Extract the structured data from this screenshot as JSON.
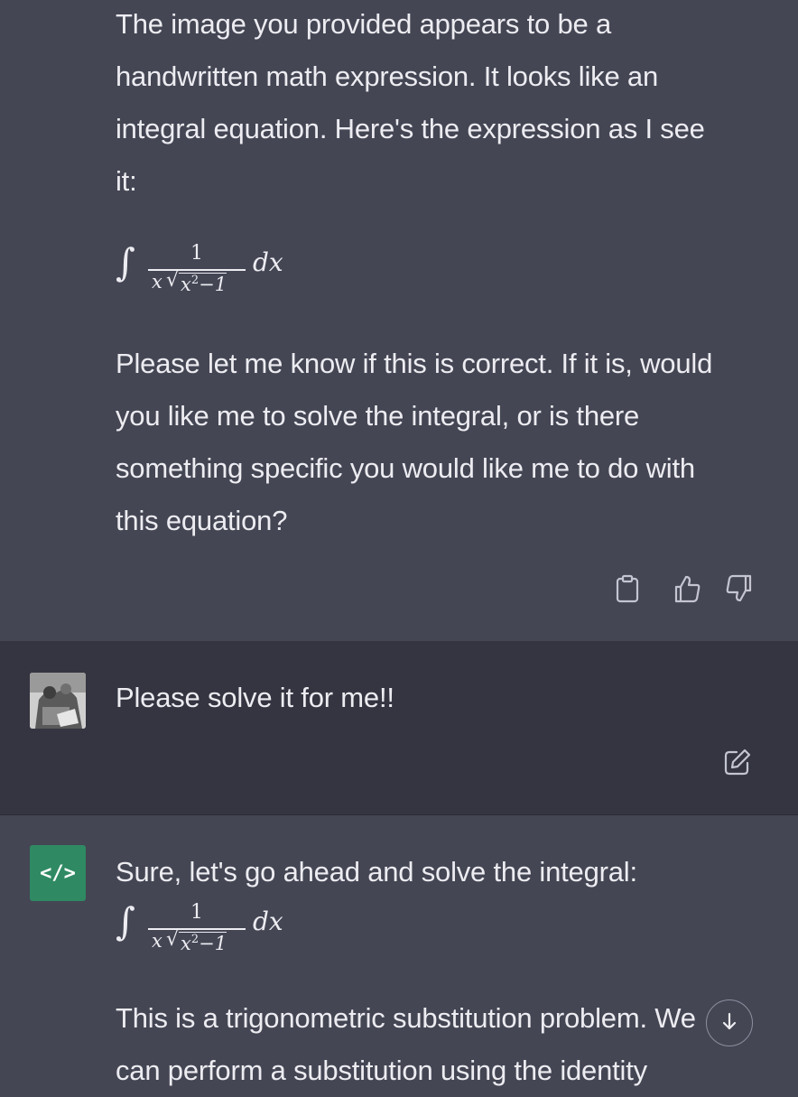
{
  "messages": {
    "first_assistant": {
      "para1_lines": [
        "The image you provided appears to be a",
        "handwritten math expression. It looks like an",
        "integral equation. Here's the expression as I see",
        "it:"
      ],
      "math": {
        "integral": "∫",
        "numerator": "1",
        "den_x": "x",
        "den_sqrt": "√",
        "den_rad": "x",
        "den_exp": "2",
        "den_rest": "−1",
        "dx": "dx"
      },
      "para2_lines": [
        "Please let me know if this is correct. If it is, would",
        "you like me to solve the integral, or is there",
        "something specific you would like me to do with",
        "this equation?"
      ],
      "actions": [
        "clipboard-icon",
        "thumbs-up-icon",
        "thumbs-down-icon"
      ]
    },
    "user": {
      "text": "Please solve it for me!!",
      "actions": [
        "edit-icon"
      ]
    },
    "second_assistant": {
      "avatar_label": "</>",
      "intro": "Sure, let's go ahead and solve the integral:",
      "math": {
        "integral": "∫",
        "numerator": "1",
        "den_x": "x",
        "den_sqrt": "√",
        "den_rad": "x",
        "den_exp": "2",
        "den_rest": "−1",
        "dx": "dx"
      },
      "para_lines": [
        "This is a trigonometric substitution problem. We",
        "can perform a substitution using the identity"
      ]
    }
  },
  "colors": {
    "assistant_bg": "#444654",
    "user_bg": "#343541",
    "bot_avatar": "#2f8a63",
    "text": "#ececf1"
  },
  "scroll_button": {
    "icon": "arrow-down-icon"
  }
}
